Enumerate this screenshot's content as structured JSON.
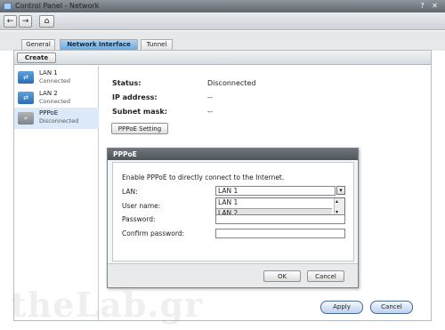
{
  "window": {
    "title": "Control Panel - Network"
  },
  "tabs": [
    {
      "label": "General"
    },
    {
      "label": "Network Interface",
      "active": true
    },
    {
      "label": "Tunnel"
    }
  ],
  "toolbar": {
    "back_icon": "back-arrow",
    "forward_icon": "forward-arrow",
    "home_icon": "home-icon"
  },
  "create_label": "Create",
  "interfaces": [
    {
      "name": "LAN 1",
      "status": "Connected",
      "icon": "ethernet-icon"
    },
    {
      "name": "LAN 2",
      "status": "Connected",
      "icon": "ethernet-icon"
    },
    {
      "name": "PPPoE",
      "status": "Disconnected",
      "icon": "pppoe-icon",
      "selected": true
    }
  ],
  "details": {
    "status_label": "Status:",
    "status_value": "Disconnected",
    "ip_label": "IP address:",
    "ip_value": "--",
    "mask_label": "Subnet mask:",
    "mask_value": "--",
    "pppoe_button": "PPPoE Setting"
  },
  "dialog": {
    "title": "PPPoE",
    "intro": "Enable PPPoE to directly connect to the Internet.",
    "lan_label": "LAN:",
    "lan_value": "LAN 1",
    "lan_options": [
      "LAN 1",
      "LAN 2"
    ],
    "user_label": "User name:",
    "password_label": "Password:",
    "confirm_label": "Confirm password:",
    "ok_label": "OK",
    "cancel_label": "Cancel"
  },
  "footer": {
    "apply_label": "Apply",
    "cancel_label": "Cancel"
  },
  "watermark": "theLab.gr"
}
